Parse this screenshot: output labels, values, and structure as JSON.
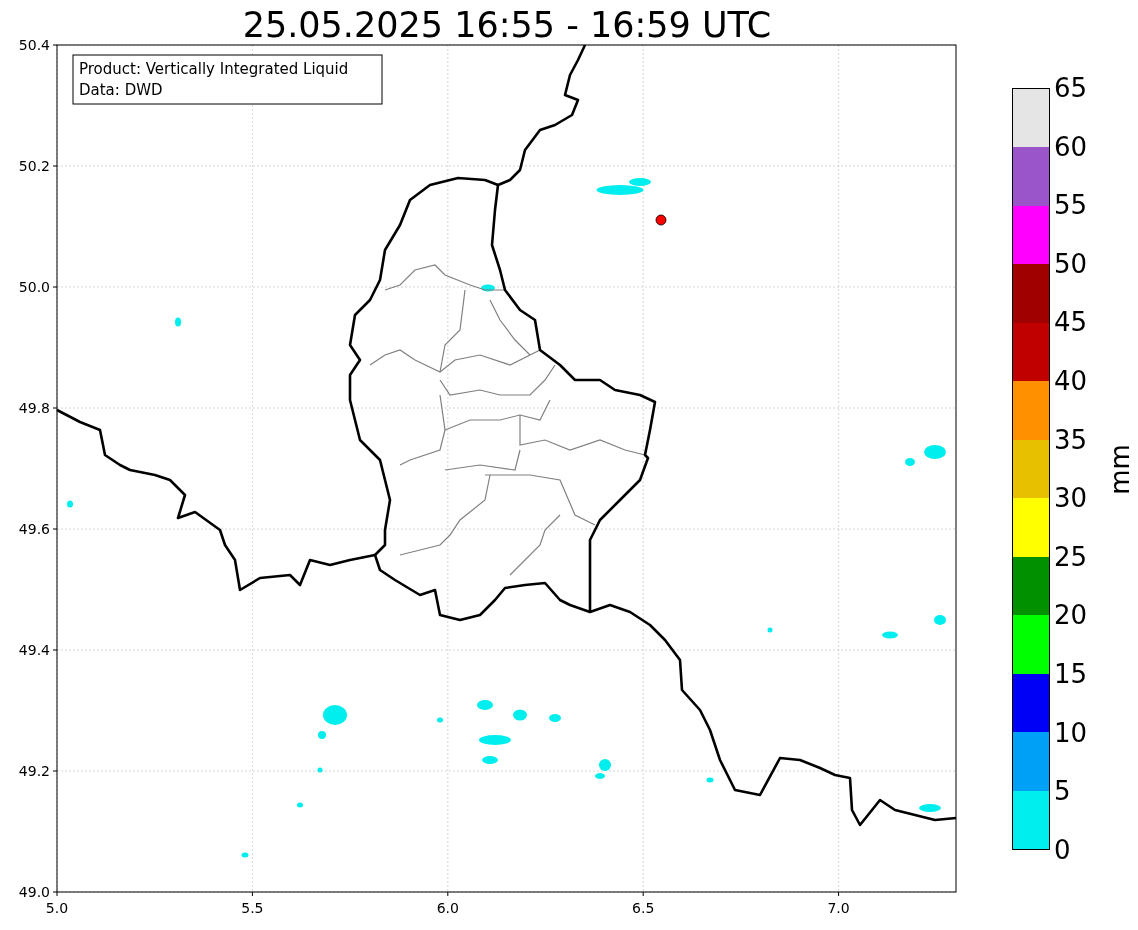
{
  "title": "25.05.2025 16:55 - 16:59 UTC",
  "map": {
    "info_box": [
      "Product: Vertically Integrated Liquid",
      "Data: DWD"
    ],
    "y_ticks": [
      "50.4",
      "50.2",
      "50.0",
      "49.8",
      "49.6",
      "49.4",
      "49.2",
      "49.0"
    ],
    "x_ticks": [
      "5.0",
      "5.5",
      "6.0",
      "6.5",
      "7.0"
    ]
  },
  "colorbar": {
    "label": "mm",
    "ticks": [
      "65",
      "60",
      "55",
      "50",
      "45",
      "40",
      "35",
      "30",
      "25",
      "20",
      "15",
      "10",
      "5",
      "0"
    ],
    "segments": [
      {
        "color": "#e5e5e5"
      },
      {
        "color": "#9955c9"
      },
      {
        "color": "#ff00ff"
      },
      {
        "color": "#a00000"
      },
      {
        "color": "#c00000"
      },
      {
        "color": "#ff9000"
      },
      {
        "color": "#e7c000"
      },
      {
        "color": "#ffff00"
      },
      {
        "color": "#009000"
      },
      {
        "color": "#00ff00"
      },
      {
        "color": "#0000f6"
      },
      {
        "color": "#00a0f6"
      },
      {
        "color": "#00eeee"
      }
    ]
  }
}
